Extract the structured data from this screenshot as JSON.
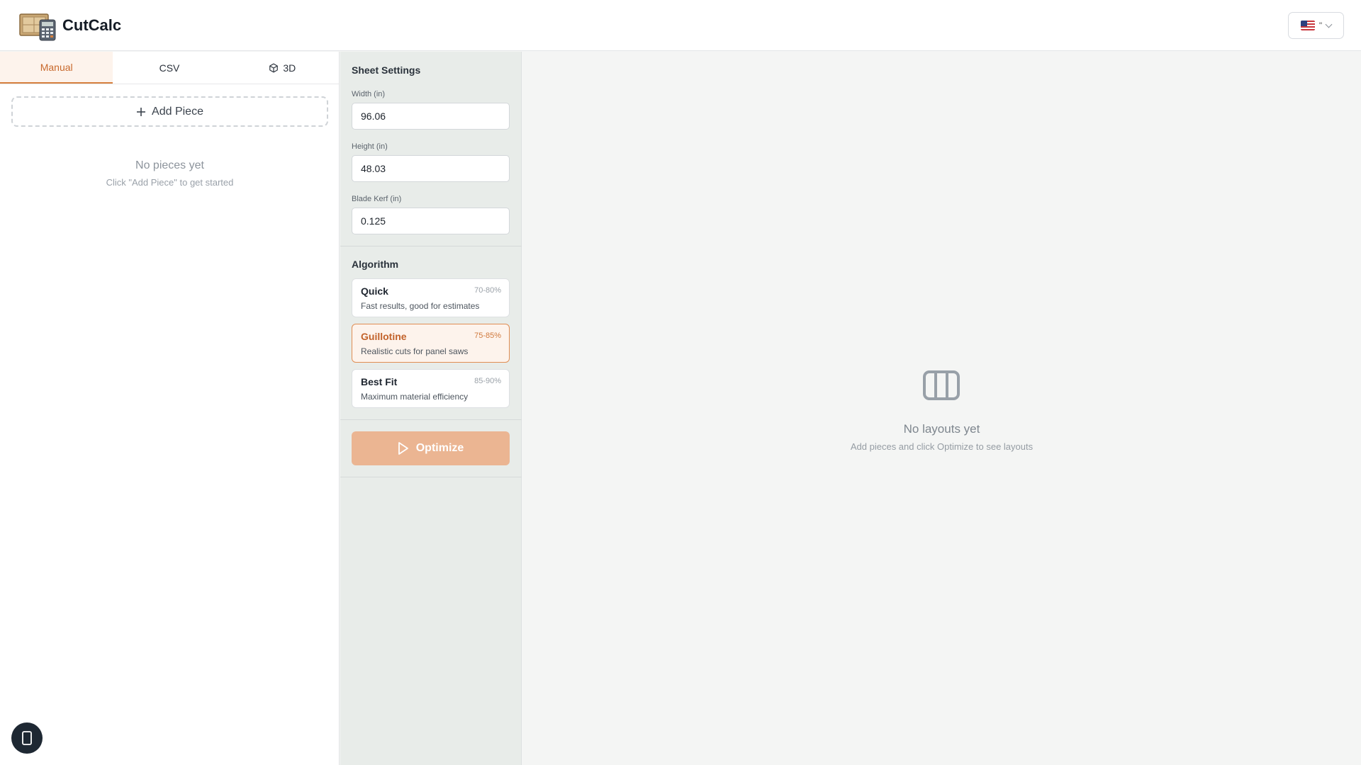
{
  "app": {
    "title": "CutCalc"
  },
  "header": {
    "language": {
      "label": "\""
    }
  },
  "left_panel": {
    "tabs": [
      {
        "label": "Manual",
        "active": true
      },
      {
        "label": "CSV",
        "active": false
      },
      {
        "label": "3D",
        "active": false,
        "icon": "cube-icon"
      }
    ],
    "add_piece_label": "Add Piece",
    "empty_title": "No pieces yet",
    "empty_subtitle": "Click \"Add Piece\" to get started"
  },
  "sheet_settings": {
    "title": "Sheet Settings",
    "width": {
      "label": "Width (in)",
      "value": "96.06"
    },
    "height": {
      "label": "Height (in)",
      "value": "48.03"
    },
    "kerf": {
      "label": "Blade Kerf (in)",
      "value": "0.125"
    }
  },
  "algorithm": {
    "title": "Algorithm",
    "options": [
      {
        "name": "Quick",
        "range": "70-80%",
        "description": "Fast results, good for estimates",
        "selected": false
      },
      {
        "name": "Guillotine",
        "range": "75-85%",
        "description": "Realistic cuts for panel saws",
        "selected": true
      },
      {
        "name": "Best Fit",
        "range": "85-90%",
        "description": "Maximum material efficiency",
        "selected": false
      }
    ]
  },
  "optimize_label": "Optimize",
  "main": {
    "empty_title": "No layouts yet",
    "empty_subtitle": "Add pieces and click Optimize to see layouts"
  },
  "colors": {
    "accent": "#d6803f",
    "accent_soft": "#ebb592",
    "dark": "#1e2833"
  }
}
